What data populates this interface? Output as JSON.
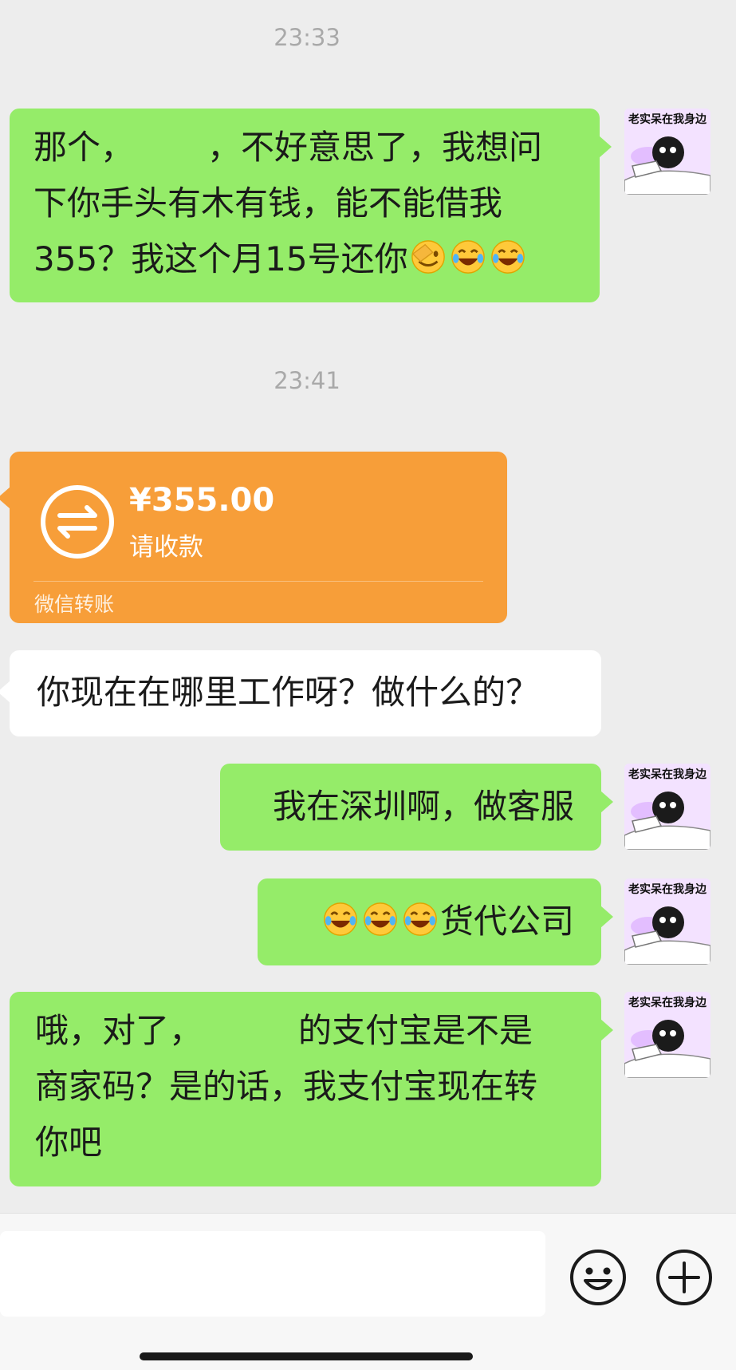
{
  "chat": {
    "timestamp_1": "23:33",
    "timestamp_2": "23:41",
    "avatar_label": "老实呆在我身边",
    "messages": {
      "msg1": {
        "line1": "那个，",
        "line1b": "，不好意思了，我想问",
        "line2": "下你手头有木有钱，能不能借我",
        "line3": "355？我这个月15号还你"
      },
      "transfer": {
        "amount": "¥355.00",
        "status": "请收款",
        "footer": "微信转账"
      },
      "msg2": "你现在在哪里工作呀？做什么的？",
      "msg3": "我在深圳啊，做客服",
      "msg4": "货代公司",
      "msg5": {
        "line1a": "哦，对了，",
        "line1b": "的支付宝是不是",
        "line2": "商家码？是的话，我支付宝现在转",
        "line3": "你吧"
      }
    }
  },
  "input_bar": {
    "emoji_icon": "smiley-icon",
    "plus_icon": "plus-icon"
  },
  "colors": {
    "background": "#ededed",
    "sent_bubble": "#95ec69",
    "received_bubble": "#ffffff",
    "transfer_card": "#f79e39",
    "timestamp": "#a9a9a9"
  }
}
